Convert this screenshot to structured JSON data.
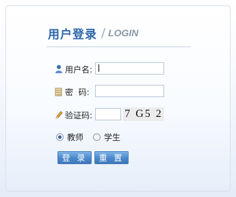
{
  "header": {
    "title_cn": "用户登录",
    "separator": "/",
    "title_en": "LOGIN"
  },
  "form": {
    "username_label": "用户名:",
    "password_label": "密  码:",
    "captcha_label": "验证码:",
    "username_value": "",
    "password_value": "",
    "captcha_value": "",
    "captcha_image_text": "7 G5 2"
  },
  "role": {
    "options": [
      {
        "label": "教师",
        "selected": true
      },
      {
        "label": "学生",
        "selected": false
      }
    ]
  },
  "buttons": {
    "login": "登 录",
    "reset": "重 置"
  },
  "icons": {
    "user": "user-icon",
    "password": "key-icon",
    "captcha": "pencil-icon"
  },
  "colors": {
    "accent": "#2d66aa",
    "button": "#4a88cc"
  }
}
